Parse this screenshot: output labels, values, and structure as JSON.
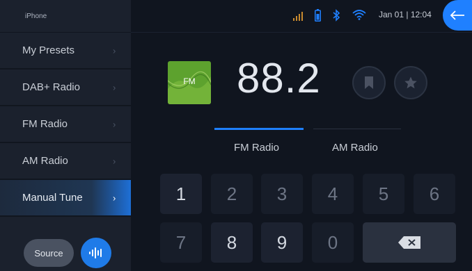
{
  "sidebar": {
    "header": "iPhone",
    "items": [
      {
        "label": "My Presets"
      },
      {
        "label": "DAB+ Radio"
      },
      {
        "label": "FM Radio"
      },
      {
        "label": "AM Radio"
      },
      {
        "label": "Manual Tune"
      }
    ],
    "source_label": "Source"
  },
  "status": {
    "datetime": "Jan 01 | 12:04"
  },
  "tuner": {
    "logo_label": "FM",
    "frequency": "88.2",
    "bands": [
      {
        "label": "FM Radio",
        "active": true
      },
      {
        "label": "AM Radio",
        "active": false
      }
    ]
  },
  "keypad": {
    "keys": [
      "1",
      "2",
      "3",
      "4",
      "5",
      "6",
      "7",
      "8",
      "9",
      "0"
    ]
  },
  "colors": {
    "accent": "#1f80ff",
    "logo_green": "#5da22e"
  }
}
